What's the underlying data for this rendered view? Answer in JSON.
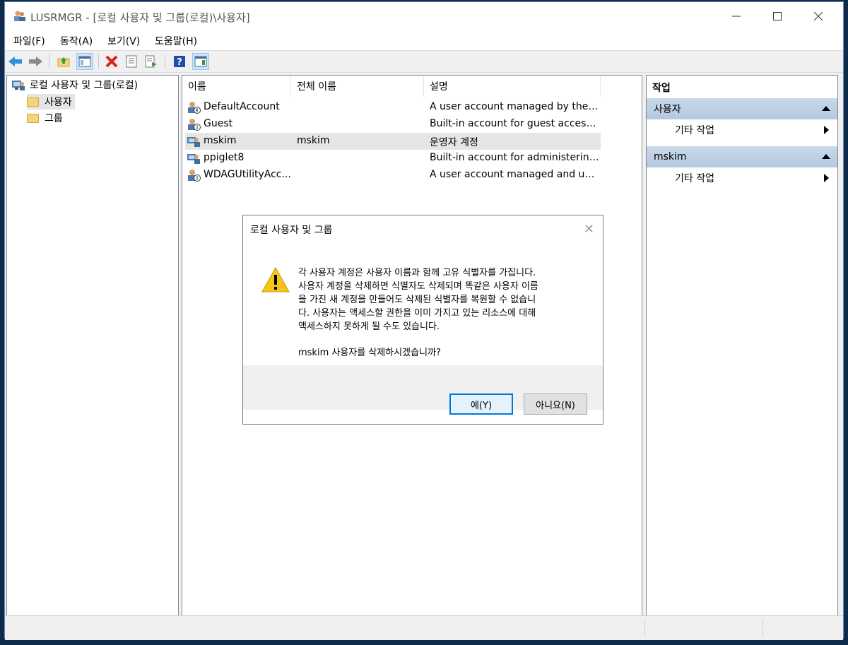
{
  "window": {
    "title": "LUSRMGR - [로컬 사용자 및 그룹(로컬)\\사용자]"
  },
  "menu": [
    "파일(F)",
    "동작(A)",
    "보기(V)",
    "도움말(H)"
  ],
  "tree": {
    "root": "로컬 사용자 및 그룹(로컬)",
    "children": [
      "사용자",
      "그룹"
    ]
  },
  "list": {
    "columns": [
      "이름",
      "전체 이름",
      "설명"
    ],
    "rows": [
      {
        "name": "DefaultAccount",
        "fullname": "",
        "desc": "A user account managed by the s..."
      },
      {
        "name": "Guest",
        "fullname": "",
        "desc": "Built-in account for guest access t..."
      },
      {
        "name": "mskim",
        "fullname": "mskim",
        "desc": "운영자 계정"
      },
      {
        "name": "ppiglet8",
        "fullname": "",
        "desc": "Built-in account for administering..."
      },
      {
        "name": "WDAGUtilityAcc...",
        "fullname": "",
        "desc": "A user account managed and use..."
      }
    ]
  },
  "actions": {
    "header": "작업",
    "sections": [
      {
        "title": "사용자",
        "item": "기타 작업"
      },
      {
        "title": "mskim",
        "item": "기타 작업"
      }
    ]
  },
  "dialog": {
    "title": "로컬 사용자 및 그룹",
    "message_lines": [
      "각 사용자 계정은 사용자 이름과 함께 고유 식별자를 가집니다.",
      "사용자 계정을 삭제하면 식별자도 삭제되며 똑같은 사용자 이름",
      "을 가진 새 계정을 만들어도 삭제된 식별자를 복원할 수 없습니",
      "다. 사용자는 액세스할 권한을 이미 가지고 있는 리소스에 대해",
      "액세스하지 못하게 될 수도 있습니다."
    ],
    "question": "mskim 사용자를 삭제하시겠습니까?",
    "yes": "예(Y)",
    "no": "아니요(N)"
  },
  "colors": {
    "selection": "#e5e5e5",
    "action_section": "#b8cce0",
    "accent": "#0078d7"
  }
}
